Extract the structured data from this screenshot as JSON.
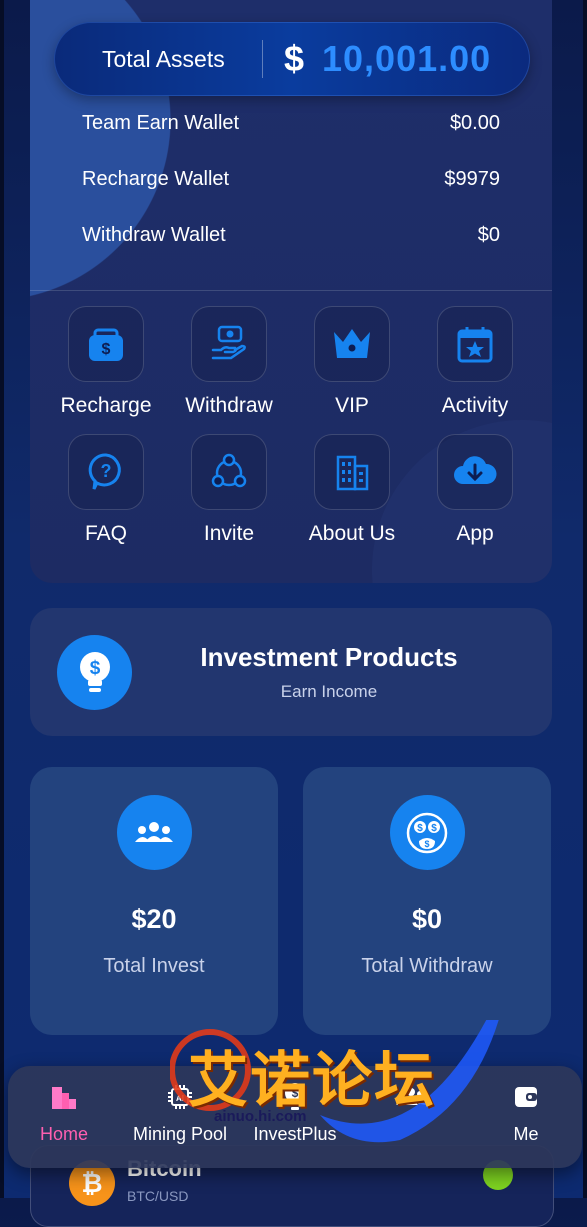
{
  "assets": {
    "total_label": "Total Assets",
    "currency": "$",
    "total_value": "10,001.00",
    "wallets": [
      {
        "name": "Team Earn Wallet",
        "value": "$0.00"
      },
      {
        "name": "Recharge Wallet",
        "value": "$9979"
      },
      {
        "name": "Withdraw Wallet",
        "value": "$0"
      }
    ]
  },
  "actions": [
    {
      "label": "Recharge",
      "icon": "briefcase-dollar-icon"
    },
    {
      "label": "Withdraw",
      "icon": "hand-money-icon"
    },
    {
      "label": "VIP",
      "icon": "crown-icon"
    },
    {
      "label": "Activity",
      "icon": "calendar-star-icon"
    },
    {
      "label": "FAQ",
      "icon": "question-bubble-icon"
    },
    {
      "label": "Invite",
      "icon": "share-nodes-icon"
    },
    {
      "label": "About Us",
      "icon": "building-icon"
    },
    {
      "label": "App",
      "icon": "cloud-download-icon"
    }
  ],
  "investment": {
    "title": "Investment Products",
    "subtitle": "Earn Income"
  },
  "stats": [
    {
      "value": "$20",
      "label": "Total Invest"
    },
    {
      "value": "$0",
      "label": "Total Withdraw"
    }
  ],
  "crypto": {
    "name": "Bitcoin",
    "pair": "BTC/USD"
  },
  "nav": [
    {
      "label": "Home",
      "icon": "home-icon",
      "active": true
    },
    {
      "label": "Mining Pool",
      "icon": "ai-chip-icon"
    },
    {
      "label": "InvestPlus",
      "icon": "bulb-dollar-icon"
    },
    {
      "label": "",
      "icon": "team-icon"
    },
    {
      "label": "Me",
      "icon": "wallet-icon"
    }
  ],
  "watermark": {
    "text": "艾诺论坛",
    "url": "ainuo.hi.com"
  },
  "colors": {
    "accent": "#1683ef",
    "total_value": "#2d8dff",
    "active_nav": "#ff5fb0"
  }
}
